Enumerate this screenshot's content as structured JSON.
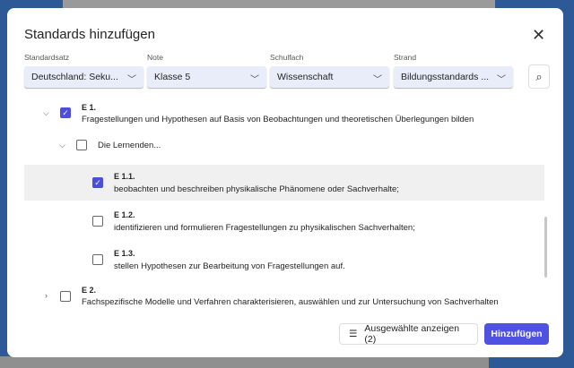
{
  "title": "Standards hinzufügen",
  "filters": [
    {
      "label": "Standardsatz",
      "value": "Deutschland: Seku..."
    },
    {
      "label": "Note",
      "value": "Klasse 5"
    },
    {
      "label": "Schulfach",
      "value": "Wissenschaft"
    },
    {
      "label": "Strand",
      "value": "Bildungsstandards ..."
    }
  ],
  "items": [
    {
      "code": "E 1.",
      "desc": "Fragestellungen und Hypothesen auf Basis von Beobachtungen und theoretischen Überlegungen bilden",
      "checked": true
    },
    {
      "desc": "Die Lernenden...",
      "checked": false
    },
    {
      "code": "E 1.1.",
      "desc": "beobachten und beschreiben physikalische Phänomene oder Sachverhalte;",
      "checked": true
    },
    {
      "code": "E 1.2.",
      "desc": "identifizieren und formulieren Fragestellungen zu physikalischen Sachverhalten;",
      "checked": false
    },
    {
      "code": "E 1.3.",
      "desc": "stellen Hypothesen zur Bearbeitung von Fragestellungen auf.",
      "checked": false
    },
    {
      "code": "E 2.",
      "desc": "Fachspezifische Modelle und Verfahren charakterisieren, auswählen und zur Untersuchung von Sachverhalten",
      "checked": false
    }
  ],
  "buttons": {
    "show_selected": "Ausgewählte anzeigen (2)",
    "add": "Hinzufügen"
  },
  "colors": {
    "accent": "#4f52e0"
  }
}
